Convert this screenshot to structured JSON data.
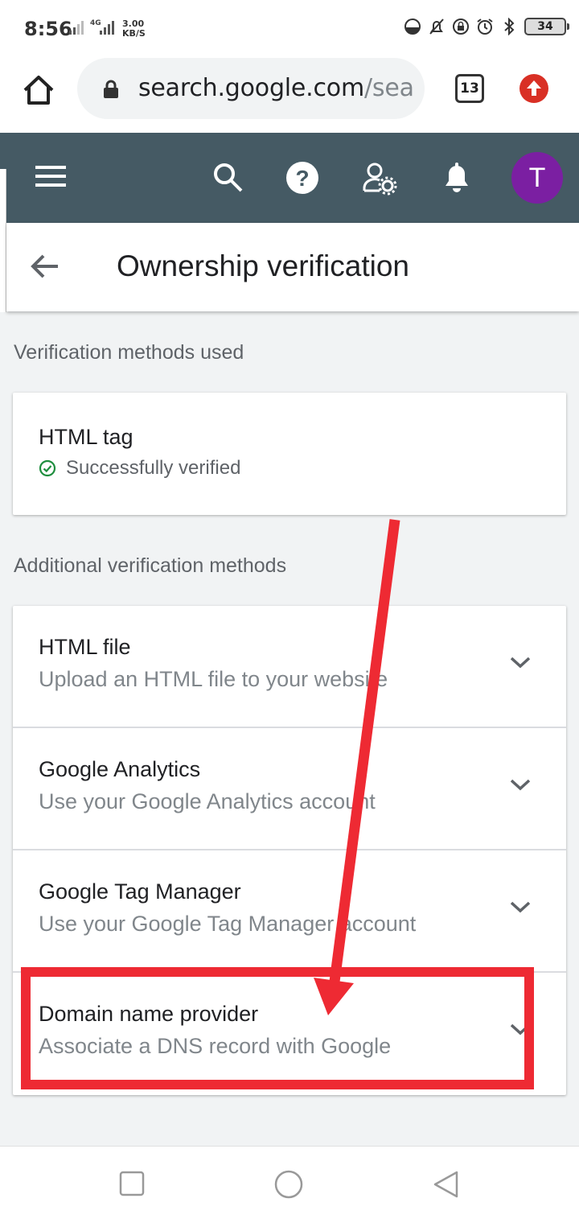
{
  "status_bar": {
    "time": "8:56",
    "net_speed_value": "3.00",
    "net_speed_unit": "KB/S",
    "network_type": "4G",
    "battery": "34"
  },
  "browser": {
    "url_host": "search.google.com",
    "url_path": "/sea",
    "tab_count": "13"
  },
  "app_bar": {
    "avatar_letter": "T",
    "avatar_color": "#7b1fa2",
    "background": "#455a64"
  },
  "page": {
    "title": "Ownership verification"
  },
  "used_section": {
    "label": "Verification methods used",
    "items": [
      {
        "title": "HTML tag",
        "status": "Successfully verified",
        "status_icon": "check-circle-icon",
        "status_color": "#1e8e3e"
      }
    ]
  },
  "additional_section": {
    "label": "Additional verification methods",
    "items": [
      {
        "title": "HTML file",
        "subtitle": "Upload an HTML file to your website"
      },
      {
        "title": "Google Analytics",
        "subtitle": "Use your Google Analytics account"
      },
      {
        "title": "Google Tag Manager",
        "subtitle": "Use your Google Tag Manager account"
      },
      {
        "title": "Domain name provider",
        "subtitle": "Associate a DNS record with Google"
      }
    ]
  },
  "annotation": {
    "color": "#ee2a33",
    "highlighted_item": "Domain name provider"
  }
}
